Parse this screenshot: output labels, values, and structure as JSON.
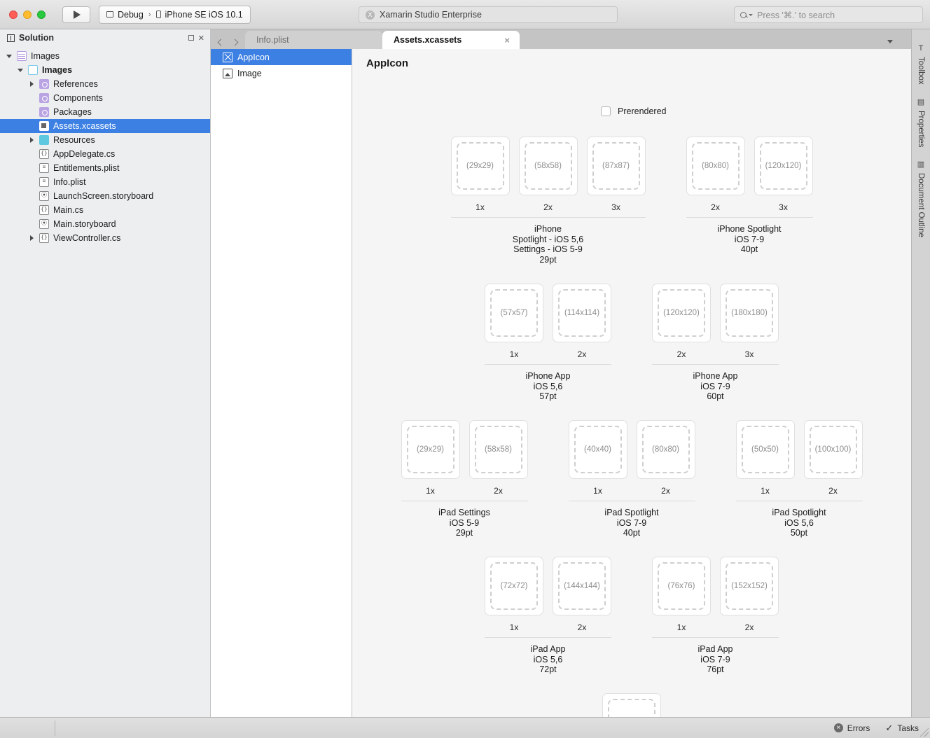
{
  "titlebar": {
    "run_label": "run-button",
    "configuration": "Debug",
    "separator": "›",
    "device": "iPhone SE iOS 10.1",
    "app_name": "Xamarin Studio Enterprise",
    "app_badge": "X",
    "search_placeholder": "Press '⌘.' to search"
  },
  "solution_pad": {
    "title": "Solution",
    "items": [
      {
        "label": "Images",
        "indent": 0,
        "icon": "solution-icon",
        "twist": "down"
      },
      {
        "label": "Images",
        "indent": 1,
        "icon": "project-icon",
        "twist": "down",
        "bold": true
      },
      {
        "label": "References",
        "indent": 2,
        "icon": "folder-purple-icon",
        "twist": "right"
      },
      {
        "label": "Components",
        "indent": 2,
        "icon": "folder-purple-icon",
        "twist": "none"
      },
      {
        "label": "Packages",
        "indent": 2,
        "icon": "folder-purple-icon",
        "twist": "none"
      },
      {
        "label": "Assets.xcassets",
        "indent": 2,
        "icon": "xcassets-icon",
        "twist": "none",
        "selected": true
      },
      {
        "label": "Resources",
        "indent": 2,
        "icon": "folder-cyan-icon",
        "twist": "right"
      },
      {
        "label": "AppDelegate.cs",
        "indent": 2,
        "icon": "csharp-file-icon",
        "twist": "none",
        "glyph": "{}"
      },
      {
        "label": "Entitlements.plist",
        "indent": 2,
        "icon": "plist-file-icon",
        "twist": "none",
        "glyph": "≡"
      },
      {
        "label": "Info.plist",
        "indent": 2,
        "icon": "plist-file-icon",
        "twist": "none",
        "glyph": "≡"
      },
      {
        "label": "LaunchScreen.storyboard",
        "indent": 2,
        "icon": "storyboard-file-icon",
        "twist": "none",
        "glyph": "⦿"
      },
      {
        "label": "Main.cs",
        "indent": 2,
        "icon": "csharp-file-icon",
        "twist": "none",
        "glyph": "{}"
      },
      {
        "label": "Main.storyboard",
        "indent": 2,
        "icon": "storyboard-file-icon",
        "twist": "none",
        "glyph": "⦿"
      },
      {
        "label": "ViewController.cs",
        "indent": 2,
        "icon": "csharp-file-icon",
        "twist": "right",
        "glyph": "{}"
      }
    ]
  },
  "document_tabs": [
    {
      "label": "Info.plist",
      "active": false,
      "closable": false
    },
    {
      "label": "Assets.xcassets",
      "active": true,
      "closable": true,
      "close_glyph": "×"
    }
  ],
  "asset_list": [
    {
      "label": "AppIcon",
      "icon": "appicon-icon",
      "selected": true
    },
    {
      "label": "Image",
      "icon": "imageset-icon",
      "selected": false
    }
  ],
  "editor": {
    "title": "AppIcon",
    "prerendered_label": "Prerendered",
    "prerendered_checked": false,
    "sections": [
      {
        "groups": [
          {
            "caption": "iPhone\nSpotlight - iOS 5,6\nSettings - iOS 5-9\n29pt",
            "tiles": [
              {
                "size": "(29x29)",
                "scale": "1x"
              },
              {
                "size": "(58x58)",
                "scale": "2x"
              },
              {
                "size": "(87x87)",
                "scale": "3x"
              }
            ]
          },
          {
            "caption": "iPhone Spotlight\niOS 7-9\n40pt",
            "tiles": [
              {
                "size": "(80x80)",
                "scale": "2x"
              },
              {
                "size": "(120x120)",
                "scale": "3x"
              }
            ]
          }
        ]
      },
      {
        "groups": [
          {
            "caption": "iPhone App\niOS 5,6\n57pt",
            "tiles": [
              {
                "size": "(57x57)",
                "scale": "1x"
              },
              {
                "size": "(114x114)",
                "scale": "2x"
              }
            ]
          },
          {
            "caption": "iPhone App\niOS 7-9\n60pt",
            "tiles": [
              {
                "size": "(120x120)",
                "scale": "2x"
              },
              {
                "size": "(180x180)",
                "scale": "3x"
              }
            ]
          }
        ]
      },
      {
        "groups": [
          {
            "caption": "iPad Settings\niOS 5-9\n29pt",
            "tiles": [
              {
                "size": "(29x29)",
                "scale": "1x"
              },
              {
                "size": "(58x58)",
                "scale": "2x"
              }
            ]
          },
          {
            "caption": "iPad Spotlight\niOS 7-9\n40pt",
            "tiles": [
              {
                "size": "(40x40)",
                "scale": "1x"
              },
              {
                "size": "(80x80)",
                "scale": "2x"
              }
            ]
          },
          {
            "caption": "iPad Spotlight\niOS 5,6\n50pt",
            "tiles": [
              {
                "size": "(50x50)",
                "scale": "1x"
              },
              {
                "size": "(100x100)",
                "scale": "2x"
              }
            ]
          }
        ]
      },
      {
        "groups": [
          {
            "caption": "iPad App\niOS 5,6\n72pt",
            "tiles": [
              {
                "size": "(72x72)",
                "scale": "1x"
              },
              {
                "size": "(144x144)",
                "scale": "2x"
              }
            ]
          },
          {
            "caption": "iPad App\niOS 7-9\n76pt",
            "tiles": [
              {
                "size": "(76x76)",
                "scale": "1x"
              },
              {
                "size": "(152x152)",
                "scale": "2x"
              }
            ]
          }
        ]
      }
    ]
  },
  "right_strip": [
    {
      "label": "Toolbox",
      "icon": "toolbox-icon",
      "glyph": "T"
    },
    {
      "label": "Properties",
      "icon": "properties-icon",
      "glyph": "▤"
    },
    {
      "label": "Document Outline",
      "icon": "outline-icon",
      "glyph": "▥"
    }
  ],
  "statusbar": {
    "errors_label": "Errors",
    "errors_glyph": "×",
    "tasks_label": "Tasks",
    "tasks_glyph": "✓"
  },
  "colors": {
    "selection_blue": "#3d80e3",
    "editor_bg": "#f5f5f5",
    "pad_bg": "#eceef0",
    "tile_border": "#e0e0e0",
    "dashed_gray": "#cfcfcf"
  }
}
